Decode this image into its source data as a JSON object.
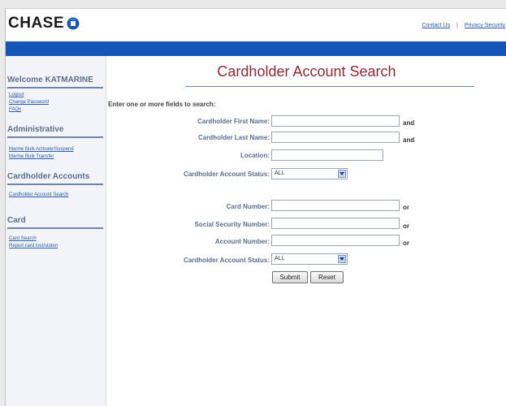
{
  "header": {
    "logo_text": "CHASE",
    "links": [
      {
        "label": "Contact Us"
      },
      {
        "label": "Privacy Security"
      }
    ],
    "link_separator": "|"
  },
  "sidebar": {
    "welcome": "Welcome KATMARINE",
    "welcome_links": [
      "Logout",
      "Change Password",
      "FAQs"
    ],
    "sections": [
      {
        "title": "Administrative",
        "links": [
          "Marine Bulk Activate/Suspend",
          "Marine Bulk Transfer"
        ]
      },
      {
        "title": "Cardholder Accounts",
        "links": [
          "Cardholder Account Search"
        ]
      },
      {
        "title": "Card",
        "links": [
          "Card Search",
          "Report card lost/stolen"
        ]
      }
    ]
  },
  "main": {
    "title": "Cardholder Account Search",
    "instructions": "Enter one or more fields to search:",
    "group1": {
      "first_name": {
        "label": "Cardholder First Name:",
        "value": "",
        "after": "and"
      },
      "last_name": {
        "label": "Cardholder Last Name:",
        "value": "",
        "after": "and"
      },
      "location": {
        "label": "Location:",
        "value": ""
      },
      "status": {
        "label": "Cardholder Account Status:",
        "value": "ALL"
      }
    },
    "group2": {
      "card_number": {
        "label": "Card Number:",
        "value": "",
        "after": "or"
      },
      "ssn": {
        "label": "Social Security Number:",
        "value": "",
        "after": "or"
      },
      "account_number": {
        "label": "Account Number:",
        "value": "",
        "after": "or"
      },
      "status": {
        "label": "Cardholder Account Status:",
        "value": "ALL"
      }
    },
    "buttons": {
      "submit": "Submit",
      "reset": "Reset"
    }
  },
  "colors": {
    "brand_blue": "#1655b8",
    "title_red": "#8b2a36",
    "label_blue": "#5a6f8f",
    "link_blue": "#2a5aa8"
  }
}
